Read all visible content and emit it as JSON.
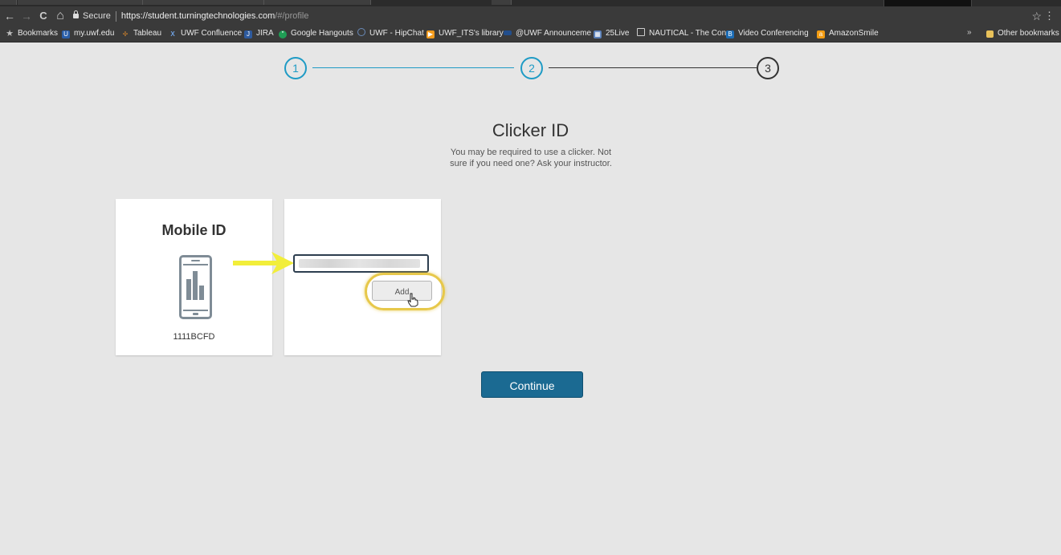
{
  "browser": {
    "secure_label": "Secure",
    "url_host": "https://student.turningtechnologies.com",
    "url_path": "/#/profile",
    "nav": {
      "back": "←",
      "forward": "→",
      "reload": "C",
      "home": "⌂"
    },
    "star": "☆",
    "menu": "⋮"
  },
  "bookmarks": {
    "items": [
      {
        "label": "Bookmarks",
        "icon": "star-icon",
        "color": "#bbbbbb"
      },
      {
        "label": "my.uwf.edu",
        "icon": "uwf-icon",
        "color": "#2a5ea8"
      },
      {
        "label": "Tableau",
        "icon": "tableau-icon",
        "color": "#e08a2a"
      },
      {
        "label": "UWF Confluence",
        "icon": "confluence-icon",
        "color": "#3a6fb0"
      },
      {
        "label": "JIRA",
        "icon": "jira-icon",
        "color": "#2d5a9e"
      },
      {
        "label": "Google Hangouts",
        "icon": "hangouts-icon",
        "color": "#1f9d55"
      },
      {
        "label": "UWF - HipChat",
        "icon": "hipchat-icon",
        "color": "#2e4a7a"
      },
      {
        "label": "UWF_ITS's library",
        "icon": "library-icon",
        "color": "#f29b1d"
      },
      {
        "label": "@UWF Announceme",
        "icon": "announce-icon",
        "color": "#224e8c"
      },
      {
        "label": "25Live",
        "icon": "25live-icon",
        "color": "#5a7fb8"
      },
      {
        "label": "NAUTICAL - The Con",
        "icon": "page-icon",
        "color": "#cccccc"
      },
      {
        "label": "Video Conferencing",
        "icon": "video-icon",
        "color": "#1c6cb5"
      },
      {
        "label": "AmazonSmile",
        "icon": "amazon-icon",
        "color": "#f39c12"
      }
    ],
    "more": "»",
    "other": "Other bookmarks"
  },
  "stepper": {
    "steps": [
      "1",
      "2",
      "3"
    ],
    "active_color": "#1f9bc5",
    "inactive_color": "#333333"
  },
  "page": {
    "title": "Clicker ID",
    "subtitle": "You may be required to use a clicker. Not sure if you need one? Ask your instructor."
  },
  "mobile_card": {
    "title": "Mobile ID",
    "device_id": "1111BCFD",
    "icon": "phone-chart-icon"
  },
  "clicker_card": {
    "input_value": "",
    "add_label": "Add"
  },
  "continue_label": "Continue",
  "colors": {
    "accent": "#1b6a92",
    "highlight": "#e7c84a",
    "arrow": "#f2ee3a"
  }
}
